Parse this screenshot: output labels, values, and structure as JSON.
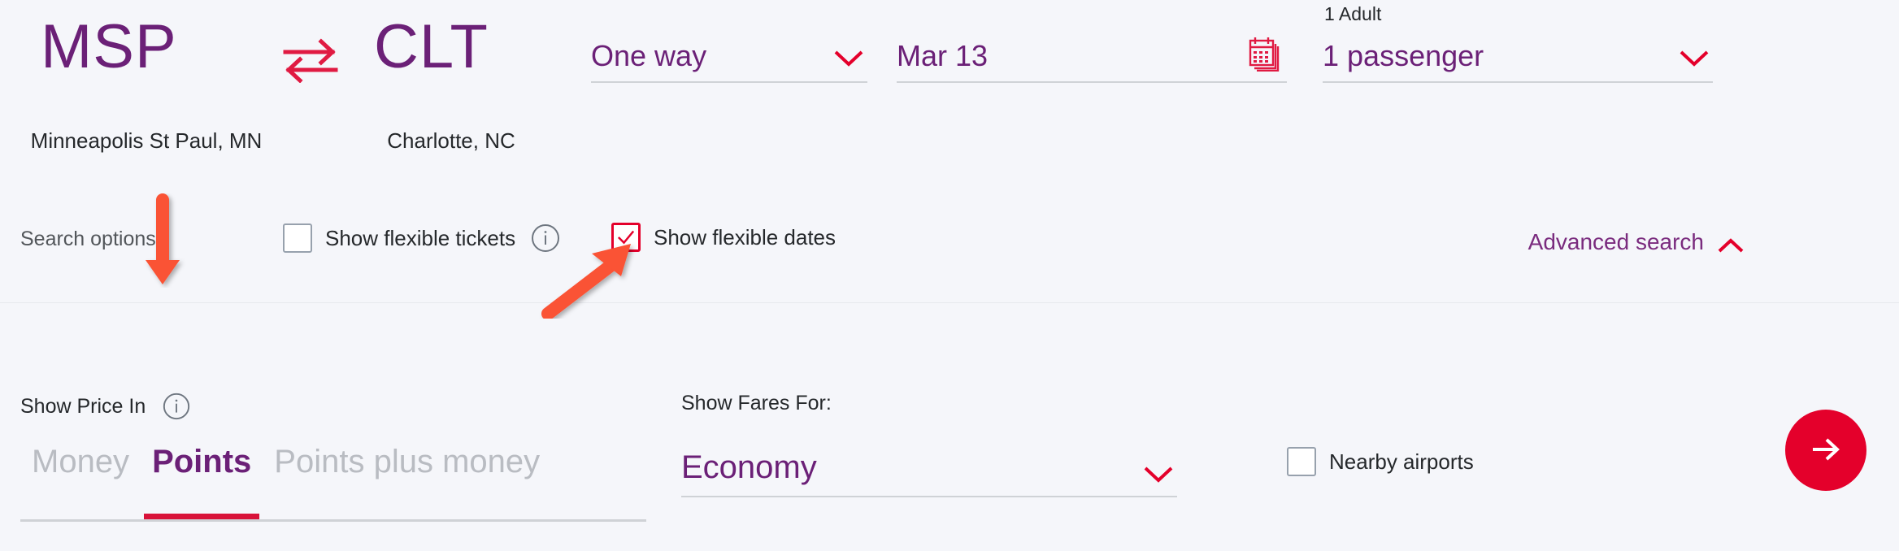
{
  "route": {
    "origin_code": "MSP",
    "origin_city": "Minneapolis St Paul, MN",
    "destination_code": "CLT",
    "destination_city": "Charlotte, NC",
    "swap_icon": "swap-horizontal-icon"
  },
  "trip": {
    "type_value": "One way",
    "type_chevron": "chevron-down-icon",
    "date_value": "Mar 13",
    "date_icon": "calendar-icon",
    "pax_sublabel": "1 Adult",
    "pax_value": "1 passenger",
    "pax_chevron": "chevron-down-icon"
  },
  "search_options": {
    "label": "Search options",
    "flexible_tickets": {
      "label": "Show flexible tickets",
      "checked": false,
      "info_icon": "info-icon"
    },
    "flexible_dates": {
      "label": "Show flexible dates",
      "checked": true
    },
    "advanced_search": {
      "label": "Advanced search",
      "chevron": "chevron-up-icon"
    }
  },
  "advanced": {
    "show_price_in": {
      "label": "Show Price In",
      "info_icon": "info-icon",
      "tabs": [
        {
          "label": "Money",
          "active": false
        },
        {
          "label": "Points",
          "active": true
        },
        {
          "label": "Points plus money",
          "active": false
        }
      ]
    },
    "show_fares_for": {
      "label": "Show Fares For:",
      "value": "Economy",
      "chevron": "chevron-down-icon"
    },
    "nearby_airports": {
      "label": "Nearby airports",
      "checked": false
    },
    "submit": {
      "icon": "arrow-right-icon"
    }
  },
  "annotations": [
    {
      "name": "arrow-down-annotation",
      "color": "#fa5236",
      "points_to": "Points"
    },
    {
      "name": "arrow-diagonal-annotation",
      "color": "#fa5236",
      "points_to": "Show flexible dates"
    }
  ],
  "colors": {
    "brand_purple": "#6b2077",
    "brand_red": "#e4002b",
    "accent_red": "#d81239",
    "background": "#f5f6fa",
    "annotation": "#fa5236"
  }
}
